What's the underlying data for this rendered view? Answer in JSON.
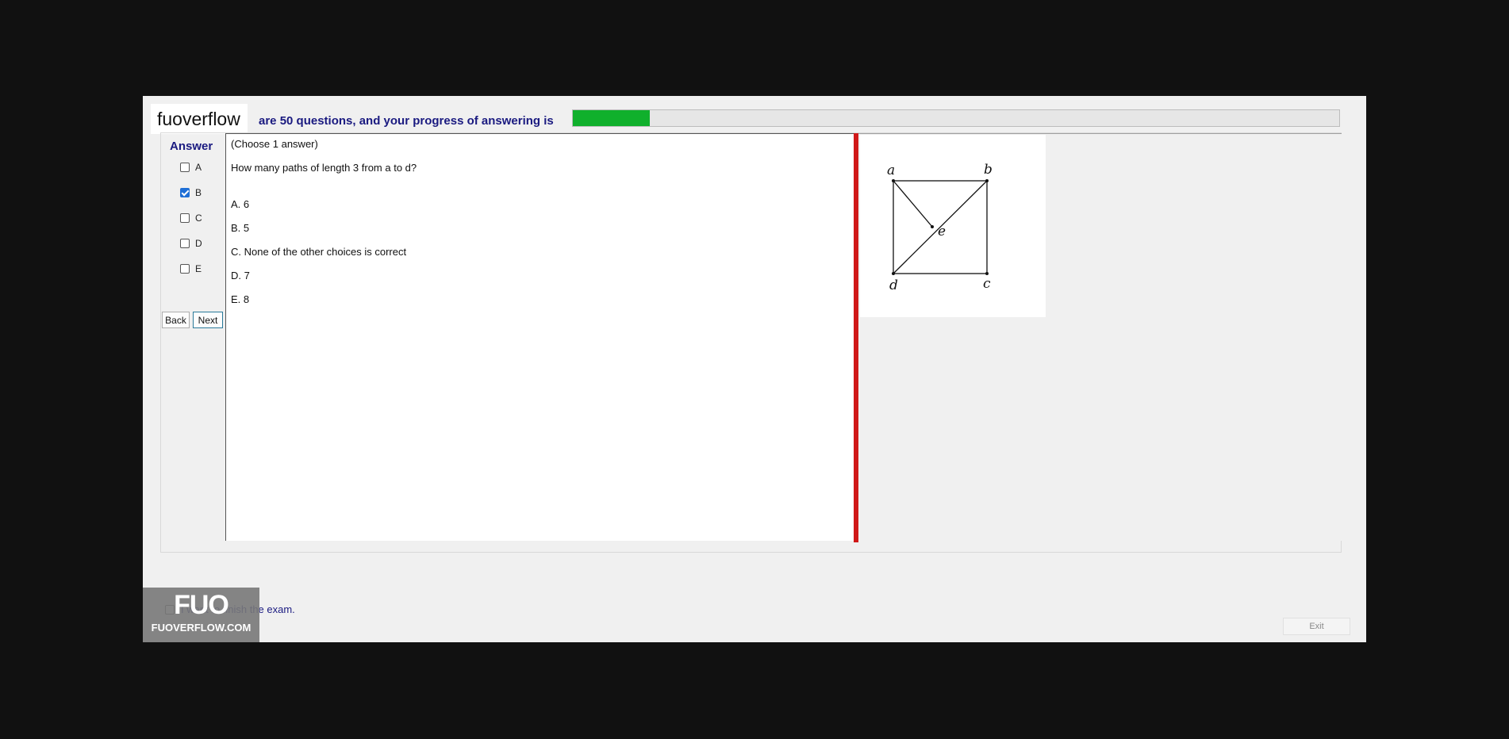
{
  "brand": "fuoverflow",
  "progress": {
    "text": "are 50 questions, and your progress of answering is",
    "fraction": 0.1
  },
  "answer": {
    "heading": "Answer",
    "options": [
      {
        "label": "A",
        "checked": false
      },
      {
        "label": "B",
        "checked": true
      },
      {
        "label": "C",
        "checked": false
      },
      {
        "label": "D",
        "checked": false
      },
      {
        "label": "E",
        "checked": false
      }
    ],
    "back_label": "Back",
    "next_label": "Next"
  },
  "question": {
    "instruction": "(Choose 1 answer)",
    "text": "How many paths of length 3 from  a to d?",
    "choices": [
      "A.  6",
      "B.  5",
      "C.  None of the other choices is correct",
      "D.  7",
      "E.  8"
    ]
  },
  "diagram": {
    "vertices": [
      "a",
      "b",
      "e",
      "d",
      "c"
    ]
  },
  "finish": {
    "label": "I want to finish the exam."
  },
  "logo": {
    "mark": "FUO",
    "sub": "FUOVERFLOW.COM"
  },
  "exit_label": "Exit",
  "colors": {
    "progress_fill": "#10b02c",
    "splitter": "#d01818",
    "heading": "#1a1a80",
    "checkbox_checked": "#1f6fd6"
  }
}
